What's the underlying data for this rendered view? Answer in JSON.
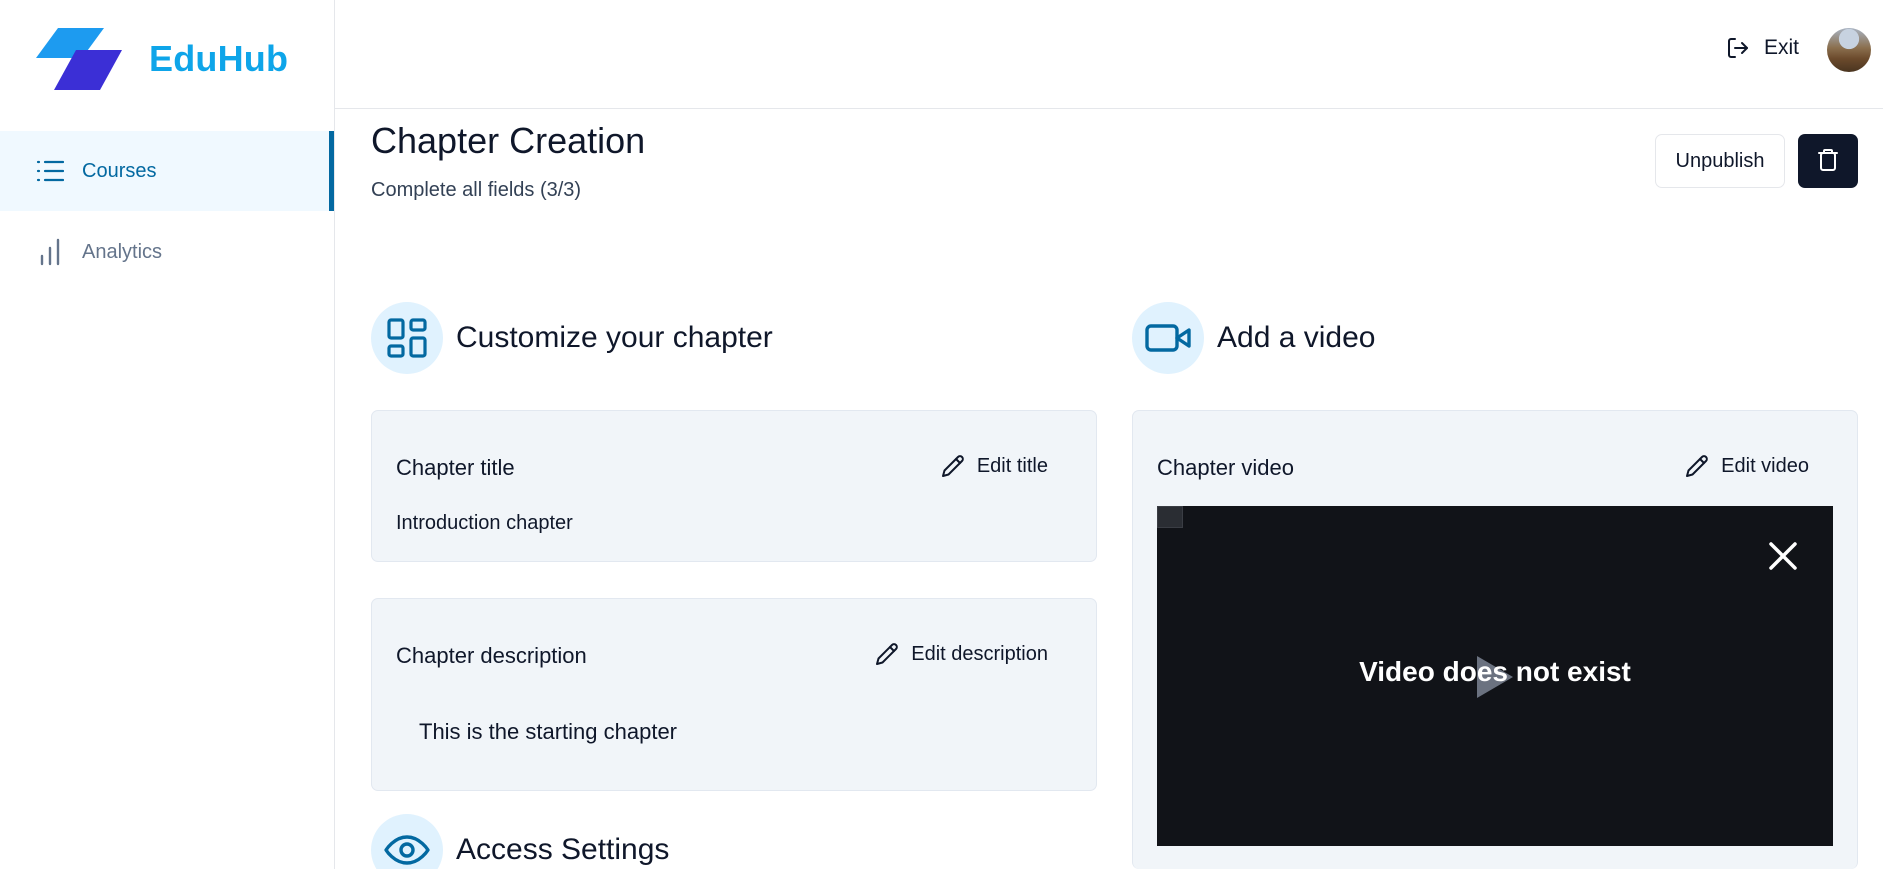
{
  "app": {
    "name": "EduHub"
  },
  "sidebar": {
    "items": [
      {
        "label": "Courses",
        "icon": "list-icon",
        "active": true
      },
      {
        "label": "Analytics",
        "icon": "bar-chart-icon",
        "active": false
      }
    ]
  },
  "header": {
    "exit_label": "Exit"
  },
  "page": {
    "title": "Chapter Creation",
    "subtitle": "Complete all fields (3/3)",
    "unpublish_label": "Unpublish"
  },
  "customize": {
    "heading": "Customize your chapter",
    "title_card": {
      "label": "Chapter title",
      "action": "Edit title",
      "value": "Introduction chapter"
    },
    "description_card": {
      "label": "Chapter description",
      "action": "Edit description",
      "value": "This is the starting chapter"
    }
  },
  "access": {
    "heading": "Access Settings"
  },
  "video": {
    "heading": "Add a video",
    "card": {
      "label": "Chapter video",
      "action": "Edit video",
      "message": "Video does not exist"
    }
  },
  "colors": {
    "brand": "#0ea5e9",
    "accent": "#0369a1",
    "card_bg": "#f1f5f9",
    "dark": "#0f172a"
  }
}
